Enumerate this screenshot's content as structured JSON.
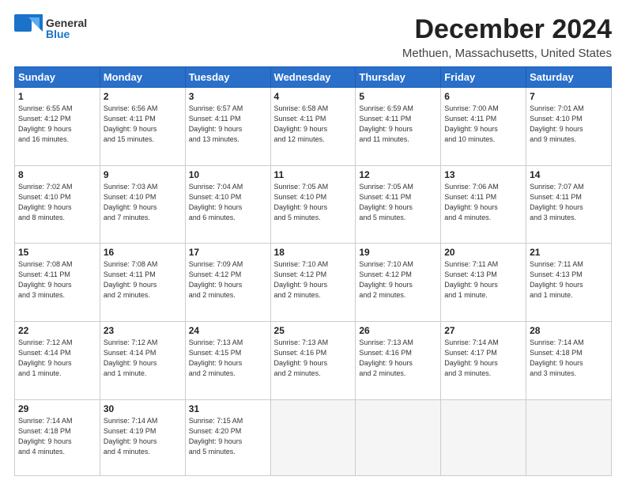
{
  "header": {
    "logo_line1": "General",
    "logo_line2": "Blue",
    "month_title": "December 2024",
    "location": "Methuen, Massachusetts, United States"
  },
  "weekdays": [
    "Sunday",
    "Monday",
    "Tuesday",
    "Wednesday",
    "Thursday",
    "Friday",
    "Saturday"
  ],
  "weeks": [
    [
      {
        "day": "1",
        "info": "Sunrise: 6:55 AM\nSunset: 4:12 PM\nDaylight: 9 hours\nand 16 minutes."
      },
      {
        "day": "2",
        "info": "Sunrise: 6:56 AM\nSunset: 4:11 PM\nDaylight: 9 hours\nand 15 minutes."
      },
      {
        "day": "3",
        "info": "Sunrise: 6:57 AM\nSunset: 4:11 PM\nDaylight: 9 hours\nand 13 minutes."
      },
      {
        "day": "4",
        "info": "Sunrise: 6:58 AM\nSunset: 4:11 PM\nDaylight: 9 hours\nand 12 minutes."
      },
      {
        "day": "5",
        "info": "Sunrise: 6:59 AM\nSunset: 4:11 PM\nDaylight: 9 hours\nand 11 minutes."
      },
      {
        "day": "6",
        "info": "Sunrise: 7:00 AM\nSunset: 4:11 PM\nDaylight: 9 hours\nand 10 minutes."
      },
      {
        "day": "7",
        "info": "Sunrise: 7:01 AM\nSunset: 4:10 PM\nDaylight: 9 hours\nand 9 minutes."
      }
    ],
    [
      {
        "day": "8",
        "info": "Sunrise: 7:02 AM\nSunset: 4:10 PM\nDaylight: 9 hours\nand 8 minutes."
      },
      {
        "day": "9",
        "info": "Sunrise: 7:03 AM\nSunset: 4:10 PM\nDaylight: 9 hours\nand 7 minutes."
      },
      {
        "day": "10",
        "info": "Sunrise: 7:04 AM\nSunset: 4:10 PM\nDaylight: 9 hours\nand 6 minutes."
      },
      {
        "day": "11",
        "info": "Sunrise: 7:05 AM\nSunset: 4:10 PM\nDaylight: 9 hours\nand 5 minutes."
      },
      {
        "day": "12",
        "info": "Sunrise: 7:05 AM\nSunset: 4:11 PM\nDaylight: 9 hours\nand 5 minutes."
      },
      {
        "day": "13",
        "info": "Sunrise: 7:06 AM\nSunset: 4:11 PM\nDaylight: 9 hours\nand 4 minutes."
      },
      {
        "day": "14",
        "info": "Sunrise: 7:07 AM\nSunset: 4:11 PM\nDaylight: 9 hours\nand 3 minutes."
      }
    ],
    [
      {
        "day": "15",
        "info": "Sunrise: 7:08 AM\nSunset: 4:11 PM\nDaylight: 9 hours\nand 3 minutes."
      },
      {
        "day": "16",
        "info": "Sunrise: 7:08 AM\nSunset: 4:11 PM\nDaylight: 9 hours\nand 2 minutes."
      },
      {
        "day": "17",
        "info": "Sunrise: 7:09 AM\nSunset: 4:12 PM\nDaylight: 9 hours\nand 2 minutes."
      },
      {
        "day": "18",
        "info": "Sunrise: 7:10 AM\nSunset: 4:12 PM\nDaylight: 9 hours\nand 2 minutes."
      },
      {
        "day": "19",
        "info": "Sunrise: 7:10 AM\nSunset: 4:12 PM\nDaylight: 9 hours\nand 2 minutes."
      },
      {
        "day": "20",
        "info": "Sunrise: 7:11 AM\nSunset: 4:13 PM\nDaylight: 9 hours\nand 1 minute."
      },
      {
        "day": "21",
        "info": "Sunrise: 7:11 AM\nSunset: 4:13 PM\nDaylight: 9 hours\nand 1 minute."
      }
    ],
    [
      {
        "day": "22",
        "info": "Sunrise: 7:12 AM\nSunset: 4:14 PM\nDaylight: 9 hours\nand 1 minute."
      },
      {
        "day": "23",
        "info": "Sunrise: 7:12 AM\nSunset: 4:14 PM\nDaylight: 9 hours\nand 1 minute."
      },
      {
        "day": "24",
        "info": "Sunrise: 7:13 AM\nSunset: 4:15 PM\nDaylight: 9 hours\nand 2 minutes."
      },
      {
        "day": "25",
        "info": "Sunrise: 7:13 AM\nSunset: 4:16 PM\nDaylight: 9 hours\nand 2 minutes."
      },
      {
        "day": "26",
        "info": "Sunrise: 7:13 AM\nSunset: 4:16 PM\nDaylight: 9 hours\nand 2 minutes."
      },
      {
        "day": "27",
        "info": "Sunrise: 7:14 AM\nSunset: 4:17 PM\nDaylight: 9 hours\nand 3 minutes."
      },
      {
        "day": "28",
        "info": "Sunrise: 7:14 AM\nSunset: 4:18 PM\nDaylight: 9 hours\nand 3 minutes."
      }
    ],
    [
      {
        "day": "29",
        "info": "Sunrise: 7:14 AM\nSunset: 4:18 PM\nDaylight: 9 hours\nand 4 minutes."
      },
      {
        "day": "30",
        "info": "Sunrise: 7:14 AM\nSunset: 4:19 PM\nDaylight: 9 hours\nand 4 minutes."
      },
      {
        "day": "31",
        "info": "Sunrise: 7:15 AM\nSunset: 4:20 PM\nDaylight: 9 hours\nand 5 minutes."
      },
      {
        "day": "",
        "info": ""
      },
      {
        "day": "",
        "info": ""
      },
      {
        "day": "",
        "info": ""
      },
      {
        "day": "",
        "info": ""
      }
    ]
  ]
}
